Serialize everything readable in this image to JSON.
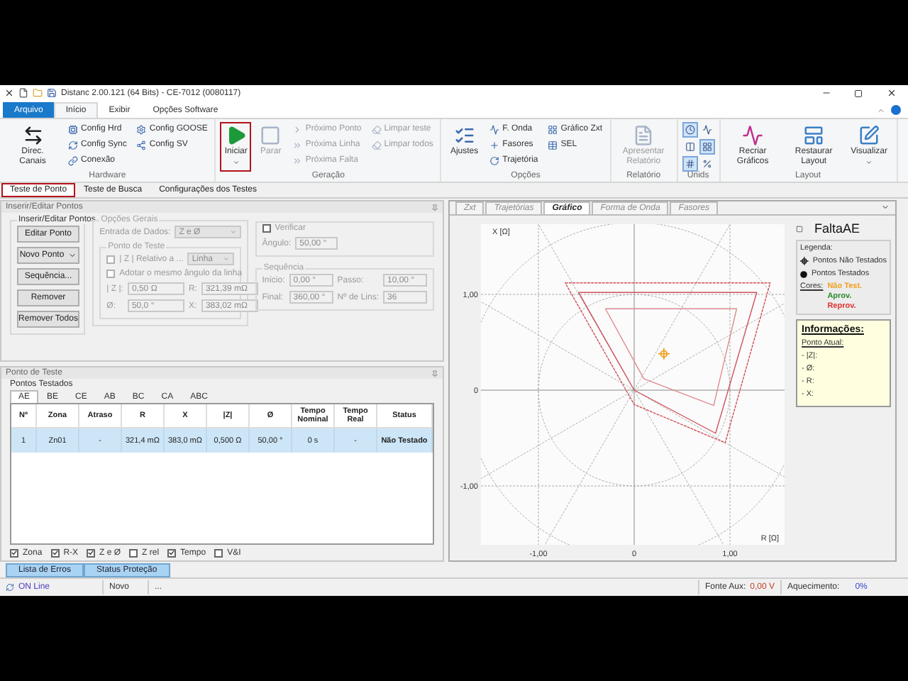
{
  "window": {
    "title": "Distanc 2.00.121 (64 Bits) - CE-7012 (0080117)"
  },
  "menu_tabs": [
    {
      "label": "Arquivo",
      "kind": "file",
      "selected": false
    },
    {
      "label": "Início",
      "kind": "tab",
      "selected": true
    },
    {
      "label": "Exibir",
      "kind": "tab",
      "selected": false
    },
    {
      "label": "Opções Software",
      "kind": "tab",
      "selected": false
    }
  ],
  "ribbon": [
    {
      "title": "Hardware",
      "kind": "buttons",
      "columns": [
        [
          {
            "label": "Direc. Canais",
            "kind": "large",
            "disabled": false,
            "highlighted": false,
            "dropdown": false
          }
        ],
        [
          {
            "label": "Config Hrd",
            "kind": "small",
            "disabled": false,
            "highlighted": false,
            "dropdown": false
          },
          {
            "label": "Config Sync",
            "kind": "small",
            "disabled": false,
            "highlighted": false,
            "dropdown": false
          },
          {
            "label": "Conexão",
            "kind": "small",
            "disabled": false,
            "highlighted": false,
            "dropdown": false
          }
        ],
        [
          {
            "label": "Config GOOSE",
            "kind": "small",
            "disabled": false,
            "highlighted": false,
            "dropdown": false
          },
          {
            "label": "Config SV",
            "kind": "small",
            "disabled": false,
            "highlighted": false,
            "dropdown": false
          }
        ]
      ]
    },
    {
      "title": "Geração",
      "kind": "buttons",
      "columns": [
        [
          {
            "label": "Iniciar",
            "kind": "large",
            "disabled": false,
            "highlighted": true,
            "dropdown": true
          }
        ],
        [
          {
            "label": "Parar",
            "kind": "large",
            "disabled": true,
            "highlighted": false,
            "dropdown": false
          }
        ],
        [
          {
            "label": "Próximo Ponto",
            "kind": "small",
            "disabled": true,
            "highlighted": false,
            "dropdown": false
          },
          {
            "label": "Próxima Linha",
            "kind": "small",
            "disabled": true,
            "highlighted": false,
            "dropdown": false
          },
          {
            "label": "Próxima Falta",
            "kind": "small",
            "disabled": true,
            "highlighted": false,
            "dropdown": false
          }
        ],
        [
          {
            "label": "Limpar teste",
            "kind": "small",
            "disabled": true,
            "highlighted": false,
            "dropdown": false
          },
          {
            "label": "Limpar todos",
            "kind": "small",
            "disabled": true,
            "highlighted": false,
            "dropdown": false
          }
        ]
      ]
    },
    {
      "title": "Opções",
      "kind": "buttons",
      "columns": [
        [
          {
            "label": "Ajustes",
            "kind": "large",
            "disabled": false,
            "highlighted": false,
            "dropdown": false
          }
        ],
        [
          {
            "label": "F. Onda",
            "kind": "small",
            "disabled": false,
            "highlighted": false,
            "dropdown": false
          },
          {
            "label": "Fasores",
            "kind": "small",
            "disabled": false,
            "highlighted": false,
            "dropdown": false
          },
          {
            "label": "Trajetória",
            "kind": "small",
            "disabled": false,
            "highlighted": false,
            "dropdown": false
          }
        ],
        [
          {
            "label": "Gráfico Zxt",
            "kind": "small",
            "disabled": false,
            "highlighted": false,
            "dropdown": false
          },
          {
            "label": "SEL",
            "kind": "small",
            "disabled": false,
            "highlighted": false,
            "dropdown": false
          }
        ]
      ]
    },
    {
      "title": "Relatório",
      "kind": "buttons",
      "columns": [
        [
          {
            "label": "Apresentar Relatório",
            "kind": "large",
            "disabled": true,
            "highlighted": false,
            "dropdown": false
          }
        ]
      ]
    },
    {
      "title": "Unids",
      "kind": "toggles",
      "toggles": [
        {
          "selected": true
        },
        {
          "selected": false
        },
        {
          "selected": false
        },
        {
          "selected": true
        },
        {
          "selected": true
        },
        {
          "selected": false
        }
      ]
    },
    {
      "title": "Layout",
      "kind": "buttons",
      "columns": [
        [
          {
            "label": "Recriar Gráficos",
            "kind": "large",
            "disabled": false,
            "highlighted": false,
            "dropdown": false
          }
        ],
        [
          {
            "label": "Restaurar Layout",
            "kind": "large",
            "disabled": false,
            "highlighted": false,
            "dropdown": false
          }
        ],
        [
          {
            "label": "Visualizar",
            "kind": "large",
            "disabled": false,
            "highlighted": false,
            "dropdown": true
          }
        ]
      ]
    }
  ],
  "doc_tabs": [
    {
      "label": "Teste de Ponto",
      "selected": true,
      "highlighted": true
    },
    {
      "label": "Teste de Busca",
      "selected": false,
      "highlighted": false
    },
    {
      "label": "Configurações dos Testes",
      "selected": false,
      "highlighted": false
    }
  ],
  "point_editor": {
    "header": "Inserir/Editar Pontos",
    "actions": {
      "title": "Inserir/Editar Pontos",
      "buttons": [
        {
          "label": "Editar Ponto",
          "kind": "button"
        },
        {
          "label": "Novo Ponto",
          "kind": "split"
        },
        {
          "label": "Sequência...",
          "kind": "button"
        },
        {
          "label": "Remover",
          "kind": "button"
        },
        {
          "label": "Remover Todos",
          "kind": "button"
        }
      ]
    },
    "general": {
      "title": "Opções Gerais",
      "disabled": true,
      "input_label": "Entrada de Dados:",
      "input_value": "Z e Ø",
      "test_point": {
        "title": "Ponto de Teste",
        "relative": {
          "label": "| Z | Relativo a ...",
          "checked": false,
          "value": "Linha"
        },
        "same_angle": {
          "label": "Adotar o mesmo ângulo da linha",
          "checked": false
        },
        "fields": [
          {
            "label": "| Z |:",
            "value": "0,50 Ω"
          },
          {
            "label": "R:",
            "value": "321,39 mΩ"
          },
          {
            "label": "Ø:",
            "value": "50,0 °"
          },
          {
            "label": "X:",
            "value": "383,02 mΩ"
          }
        ]
      }
    },
    "verify": {
      "label": "Verificar",
      "checked": false,
      "angle_label": "Ângulo:",
      "angle_value": "50,00 °"
    },
    "sequence": {
      "title": "Sequência",
      "fields": [
        {
          "label": "Início:",
          "value": "0,00 °"
        },
        {
          "label": "Passo:",
          "value": "10,00 °"
        },
        {
          "label": "Final:",
          "value": "360,00 °"
        },
        {
          "label": "Nº de Lins:",
          "value": "36"
        }
      ]
    }
  },
  "test_points": {
    "header": "Ponto de Teste",
    "subtitle": "Pontos Testados",
    "tabs": [
      {
        "label": "AE",
        "selected": true
      },
      {
        "label": "BE",
        "selected": false
      },
      {
        "label": "CE",
        "selected": false
      },
      {
        "label": "AB",
        "selected": false
      },
      {
        "label": "BC",
        "selected": false
      },
      {
        "label": "CA",
        "selected": false
      },
      {
        "label": "ABC",
        "selected": false
      }
    ],
    "columns": [
      "Nº",
      "Zona",
      "Atraso",
      "R",
      "X",
      "|Z|",
      "Ø",
      "Tempo Nominal",
      "Tempo Real",
      "Status"
    ],
    "rows": [
      {
        "selected": true,
        "cells": [
          "1",
          "Zn01",
          "-",
          "321,4 mΩ",
          "383,0 mΩ",
          "0,500 Ω",
          "50,00 °",
          "0 s",
          "-",
          "Não Testado"
        ]
      }
    ],
    "options": [
      {
        "label": "Zona",
        "checked": true
      },
      {
        "label": "R-X",
        "checked": true
      },
      {
        "label": "Z e Ø",
        "checked": true
      },
      {
        "label": "Z rel",
        "checked": false
      },
      {
        "label": "Tempo",
        "checked": true
      },
      {
        "label": "V&I",
        "checked": false
      }
    ]
  },
  "bottom_tabs": [
    {
      "label": "Lista de Erros"
    },
    {
      "label": "Status Proteção"
    }
  ],
  "status_bar": {
    "connection": "ON Line",
    "mode": "Novo",
    "info": "...",
    "aux_label": "Fonte Aux:",
    "aux_value": "0,00 V",
    "heat_label": "Aquecimento:",
    "heat_value": "0%"
  },
  "graph_panel": {
    "tabs": [
      {
        "label": "Zxt",
        "selected": false
      },
      {
        "label": "Trajetórias",
        "selected": false
      },
      {
        "label": "Gráfico",
        "selected": true
      },
      {
        "label": "Forma de Onda",
        "selected": false
      },
      {
        "label": "Fasores",
        "selected": false
      }
    ],
    "plot": {
      "ylabel": "X [Ω]",
      "xlabel": "R [Ω]",
      "yticks": [
        "1,00",
        "0",
        "-1,00"
      ],
      "xticks": [
        "-1,00",
        "0",
        "1,00"
      ]
    },
    "title": "FaltaAE",
    "legend": {
      "title": "Legenda:",
      "items": [
        {
          "label": "Pontos Não Testados",
          "kind": "untested"
        },
        {
          "label": "Pontos Testados",
          "kind": "tested"
        }
      ],
      "colors_label": "Cores:",
      "colors": [
        {
          "label": "Não Test.",
          "color": "#f0a020"
        },
        {
          "label": "Aprov.",
          "color": "#2a8a2a"
        },
        {
          "label": "Reprov.",
          "color": "#e03030"
        }
      ]
    },
    "info": {
      "title": "Informações:",
      "subtitle": "Ponto Atual:",
      "lines": [
        "- |Z|:",
        "- Ø:",
        "- R:",
        "- X:"
      ]
    }
  }
}
